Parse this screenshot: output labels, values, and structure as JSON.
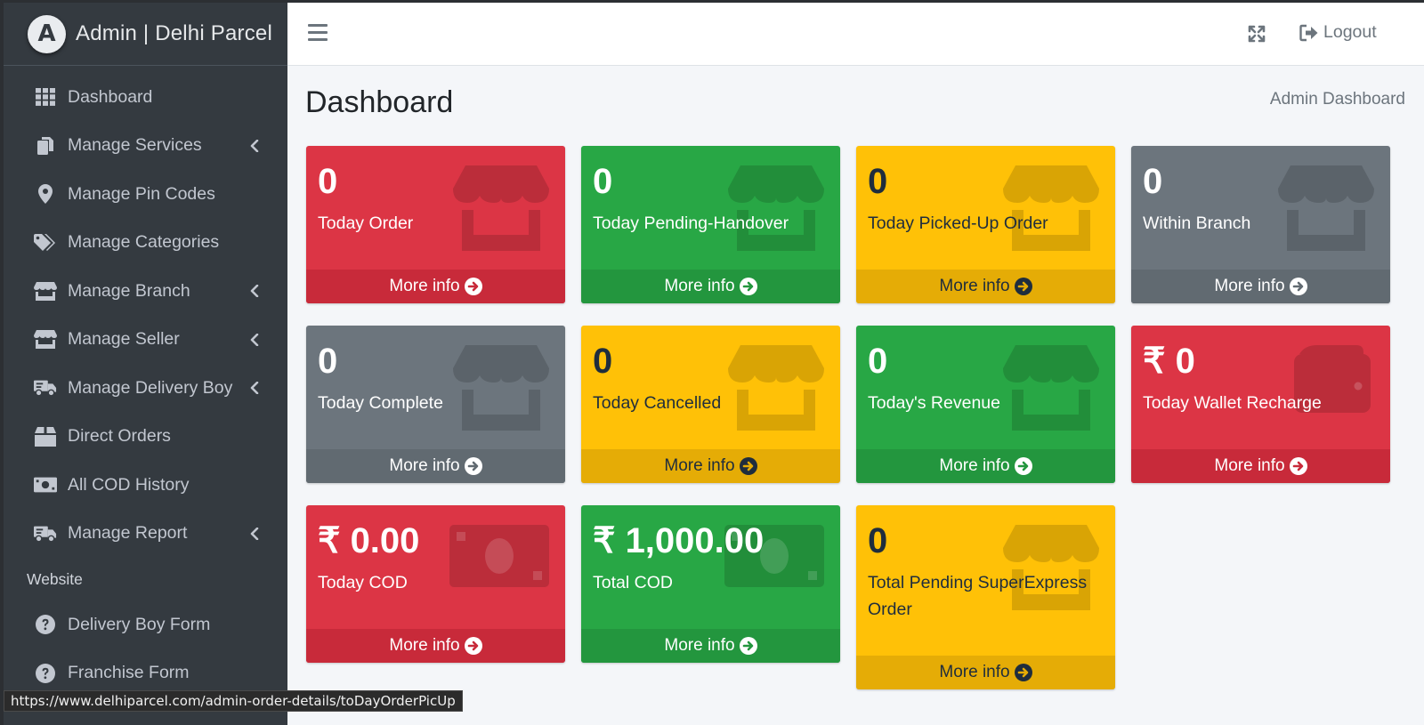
{
  "brand": {
    "logo_letter": "A",
    "title": "Admin | Delhi Parcel"
  },
  "sidebar": {
    "items": [
      {
        "label": "Dashboard",
        "icon": "grid-icon",
        "has_chevron": false
      },
      {
        "label": "Manage Services",
        "icon": "copy-icon",
        "has_chevron": true
      },
      {
        "label": "Manage Pin Codes",
        "icon": "map-marker-icon",
        "has_chevron": false
      },
      {
        "label": "Manage Categories",
        "icon": "tags-icon",
        "has_chevron": false
      },
      {
        "label": "Manage Branch",
        "icon": "store-icon",
        "has_chevron": true
      },
      {
        "label": "Manage Seller",
        "icon": "store-icon",
        "has_chevron": true
      },
      {
        "label": "Manage Delivery Boy",
        "icon": "truck-icon",
        "has_chevron": true
      },
      {
        "label": "Direct Orders",
        "icon": "box-icon",
        "has_chevron": false
      },
      {
        "label": "All COD History",
        "icon": "money-bill-icon",
        "has_chevron": false
      },
      {
        "label": "Manage Report",
        "icon": "truck-icon",
        "has_chevron": true
      }
    ],
    "section_header": "Website",
    "website_items": [
      {
        "label": "Delivery Boy Form",
        "icon": "question-circle-icon"
      },
      {
        "label": "Franchise Form",
        "icon": "question-circle-icon"
      }
    ]
  },
  "topbar": {
    "logout_label": "Logout"
  },
  "page": {
    "title": "Dashboard",
    "breadcrumb": "Admin Dashboard"
  },
  "cards": [
    {
      "value": "0",
      "label": "Today Order",
      "color": "red",
      "icon": "store-icon",
      "footer": "More info"
    },
    {
      "value": "0",
      "label": "Today Pending-Handover",
      "color": "green",
      "icon": "store-icon",
      "footer": "More info"
    },
    {
      "value": "0",
      "label": "Today Picked-Up Order",
      "color": "yellow",
      "icon": "store-icon",
      "footer": "More info"
    },
    {
      "value": "0",
      "label": "Within Branch",
      "color": "gray",
      "icon": "store-icon",
      "footer": "More info"
    },
    {
      "value": "0",
      "label": "Today Complete",
      "color": "gray",
      "icon": "store-icon",
      "footer": "More info"
    },
    {
      "value": "0",
      "label": "Today Cancelled",
      "color": "yellow",
      "icon": "store-icon",
      "footer": "More info"
    },
    {
      "value": "0",
      "label": "Today's Revenue",
      "color": "green",
      "icon": "store-icon",
      "footer": "More info"
    },
    {
      "value": "₹ 0",
      "label": "Today Wallet Recharge",
      "color": "red",
      "icon": "wallet-icon",
      "footer": "More info"
    },
    {
      "value": "₹ 0.00",
      "label": "Today COD",
      "color": "red",
      "icon": "money-bill-icon",
      "footer": "More info"
    },
    {
      "value": "₹ 1,000.00",
      "label": "Total COD",
      "color": "green",
      "icon": "money-bill-icon",
      "footer": "More info"
    },
    {
      "value": "0",
      "label": "Total Pending SuperExpress Order",
      "color": "yellow",
      "icon": "store-icon",
      "footer": "More info"
    }
  ],
  "status_url": "https://www.delhiparcel.com/admin-order-details/toDayOrderPicUp"
}
